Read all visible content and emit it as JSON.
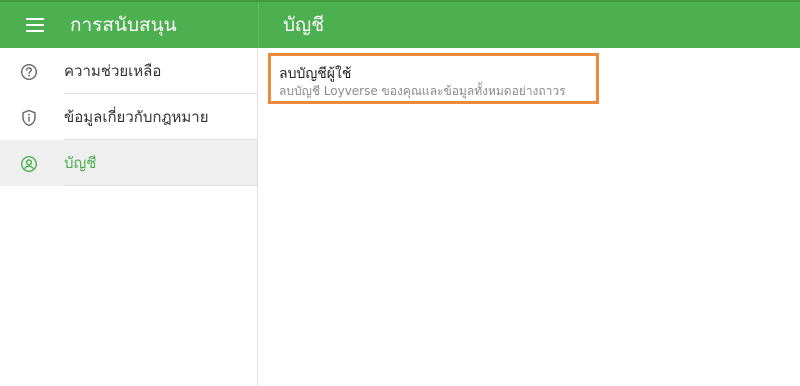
{
  "header": {
    "menu_icon": "hamburger-menu-icon",
    "section_title": "การสนับสนุน",
    "page_title": "บัญชี"
  },
  "sidebar": {
    "items": [
      {
        "label": "ความช่วยเหลือ",
        "icon": "help-circle-icon",
        "active": false
      },
      {
        "label": "ข้อมูลเกี่ยวกับกฎหมาย",
        "icon": "shield-info-icon",
        "active": false
      },
      {
        "label": "บัญชี",
        "icon": "account-circle-icon",
        "active": true
      }
    ]
  },
  "content": {
    "delete_card": {
      "title": "ลบบัญชีผู้ใช้",
      "subtitle": "ลบบัญชี Loyverse ของคุณและข้อมูลทั้งหมดอย่างถาวร"
    }
  },
  "colors": {
    "brand_green": "#4caf50",
    "highlight_orange": "#ef8a3c",
    "active_bg": "#efefef"
  }
}
